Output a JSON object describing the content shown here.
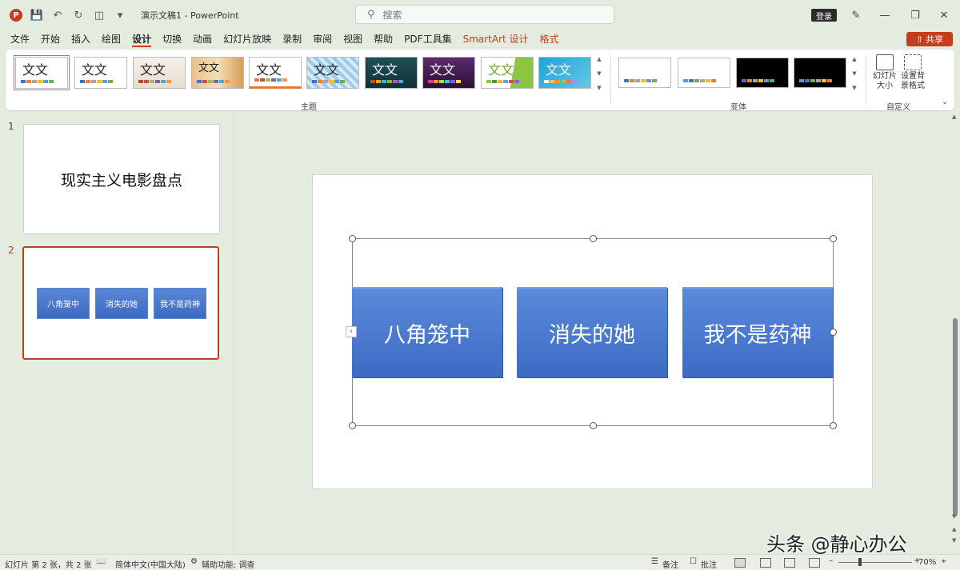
{
  "titlebar": {
    "doc_title": "演示文稿1 - PowerPoint",
    "search_placeholder": "搜索",
    "login": "登录"
  },
  "menu": {
    "tabs": [
      "文件",
      "开始",
      "插入",
      "绘图",
      "设计",
      "切换",
      "动画",
      "幻灯片放映",
      "录制",
      "审阅",
      "视图",
      "帮助",
      "PDF工具集"
    ],
    "context_tabs": [
      "SmartArt 设计",
      "格式"
    ],
    "active": "设计",
    "share": "共享"
  },
  "ribbon": {
    "themes_label": "主题",
    "variants_label": "变体",
    "custom_label": "自定义",
    "theme_sample_text": "文文",
    "slide_size": "幻灯片大小",
    "bg_format": "设置背景格式"
  },
  "slides": {
    "thumb1_num": "1",
    "thumb1_title": "现实主义电影盘点",
    "thumb2_num": "2"
  },
  "smartart": {
    "items": [
      "八角笼中",
      "消失的她",
      "我不是药神"
    ]
  },
  "statusbar": {
    "slide_info": "幻灯片 第 2 张，共 2 张",
    "language": "简体中文(中国大陆)",
    "accessibility": "辅助功能: 调查",
    "notes": "备注",
    "comments": "批注",
    "zoom": "70%"
  },
  "watermark": "头条 @静心办公",
  "colors": {
    "accent": "#c43e1c",
    "smartart_fill": "#4472c4",
    "background": "#e4ece0"
  }
}
